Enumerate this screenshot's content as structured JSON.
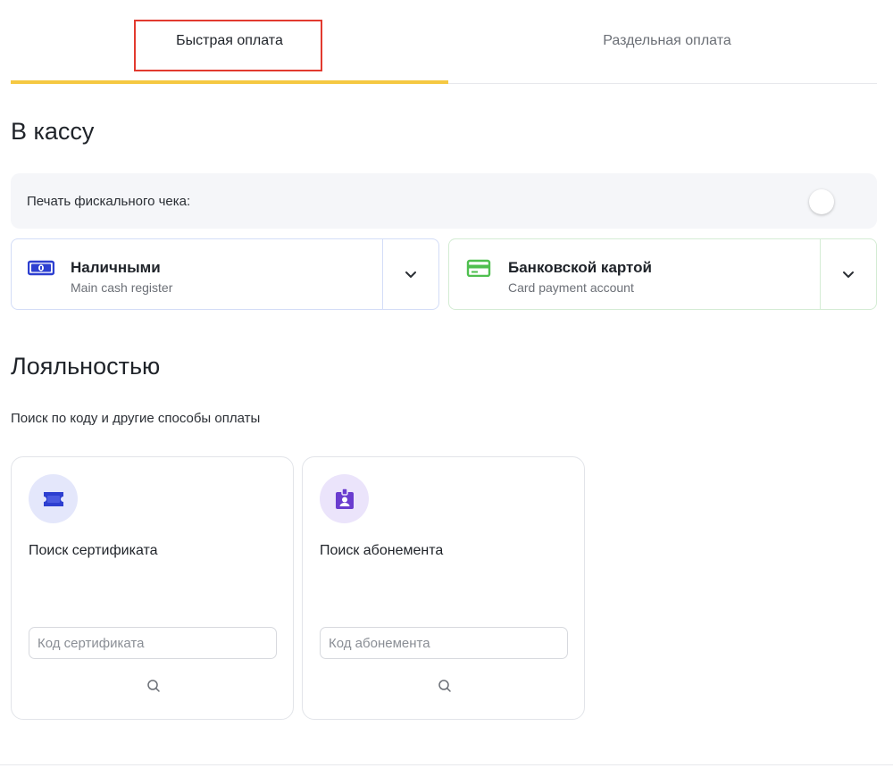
{
  "tabs": {
    "fast_label": "Быстрая оплата",
    "split_label": "Раздельная оплата"
  },
  "cash_section": {
    "title": "В кассу",
    "fiscal_label": "Печать фискального чека:",
    "fiscal_enabled": false,
    "methods": [
      {
        "title": "Наличными",
        "subtitle": "Main cash register",
        "icon": "banknote-icon",
        "color": "#2d3fd0"
      },
      {
        "title": "Банковской картой",
        "subtitle": "Card payment account",
        "icon": "credit-card-icon",
        "color": "#4fbf4f"
      }
    ]
  },
  "loyalty_section": {
    "title": "Лояльностью",
    "subtitle": "Поиск по коду и другие способы оплаты",
    "cards": [
      {
        "title": "Поиск сертификата",
        "placeholder": "Код сертификата",
        "icon": "ticket-icon",
        "color": "#2d3fd0"
      },
      {
        "title": "Поиск абонемента",
        "placeholder": "Код абонемента",
        "icon": "id-badge-icon",
        "color": "#6a3ccf"
      }
    ]
  },
  "colors": {
    "active_tab_underline": "#f5c842",
    "highlight_frame": "#e23a2f"
  }
}
